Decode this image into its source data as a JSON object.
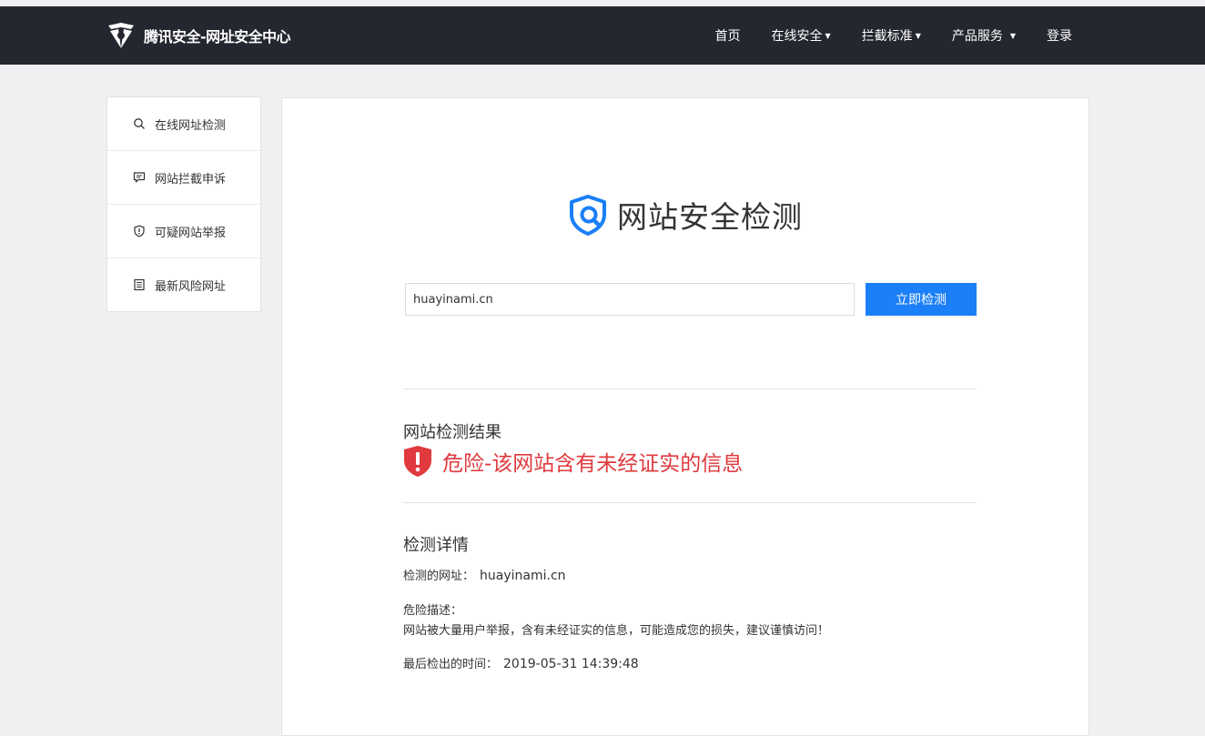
{
  "header": {
    "brand": "腾讯安全-网址安全中心",
    "nav": [
      {
        "label": "首页",
        "has_caret": false
      },
      {
        "label": "在线安全",
        "has_caret": true
      },
      {
        "label": "拦截标准",
        "has_caret": true
      },
      {
        "label": "产品服务",
        "has_caret": true
      },
      {
        "label": "登录",
        "has_caret": false
      }
    ]
  },
  "sidebar": {
    "items": [
      {
        "label": "在线网址检测",
        "icon": "search-icon"
      },
      {
        "label": "网站拦截申诉",
        "icon": "chat-icon"
      },
      {
        "label": "可疑网站举报",
        "icon": "shield-alert-icon"
      },
      {
        "label": "最新风险网址",
        "icon": "document-list-icon"
      }
    ]
  },
  "main": {
    "title": "网站安全检测",
    "search": {
      "value": "huayinami.cn",
      "button": "立即检测"
    },
    "result": {
      "title": "网站检测结果",
      "status": "危险-该网站含有未经证实的信息",
      "icon": "danger-shield-icon"
    },
    "details": {
      "title": "检测详情",
      "url_label": "检测的网址：",
      "url_value": "huayinami.cn",
      "desc_label": "危险描述：",
      "desc_text": "网站被大量用户举报，含有未经证实的信息，可能造成您的损失，建议谨慎访问！",
      "time_label": "最后检出的时间：",
      "time_value": "2019-05-31 14:39:48"
    }
  },
  "colors": {
    "header_bg": "#252730",
    "primary": "#1b7ff7",
    "danger": "#e0393e",
    "page_bg": "#f0f0f3"
  }
}
